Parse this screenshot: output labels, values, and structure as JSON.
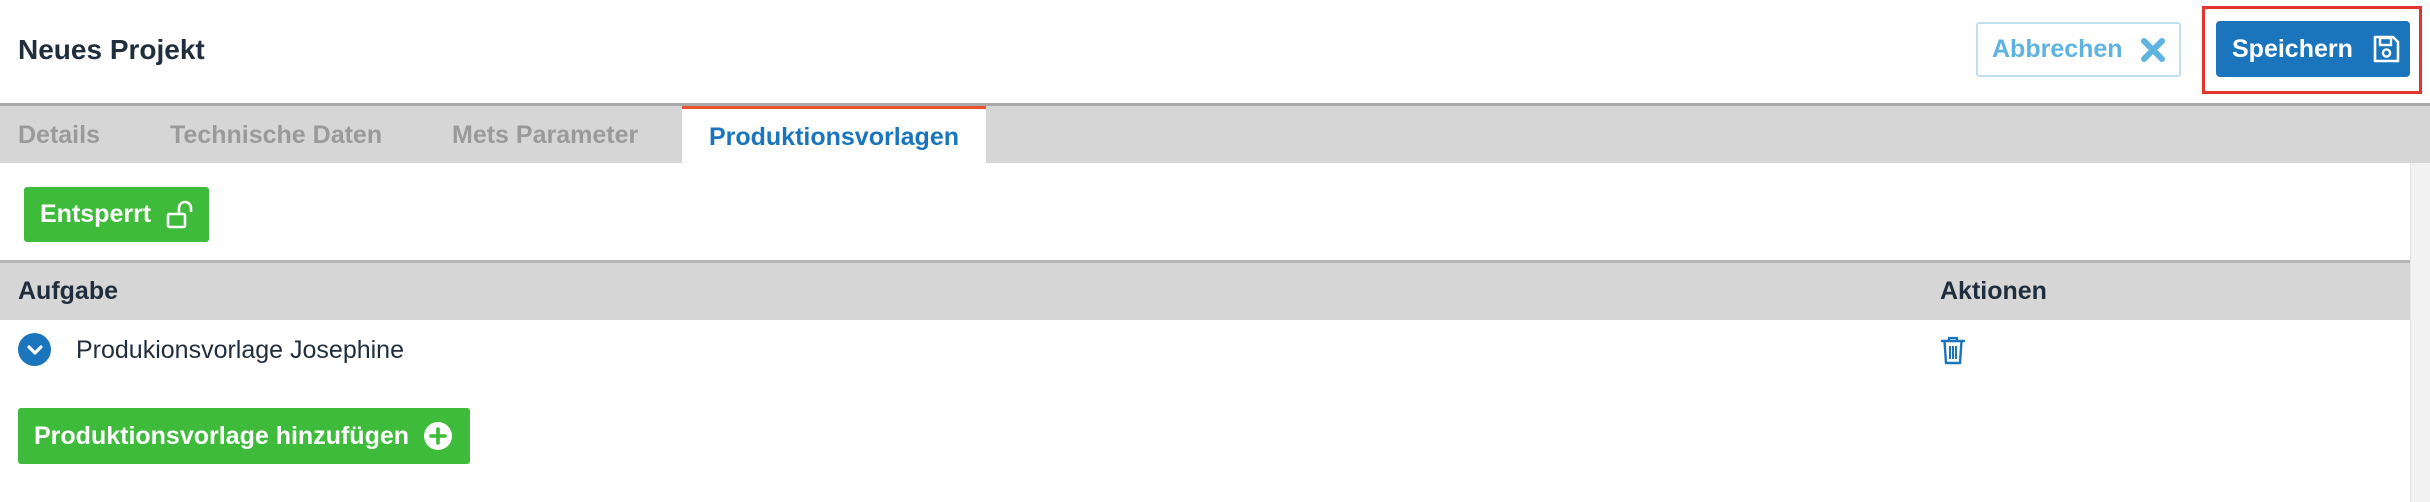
{
  "header": {
    "title": "Neues Projekt",
    "cancel_label": "Abbrechen",
    "cancel_icon": "close-icon",
    "save_label": "Speichern",
    "save_icon": "floppy-disk-icon"
  },
  "tabs": [
    {
      "label": "Details",
      "active": false
    },
    {
      "label": "Technische Daten",
      "active": false
    },
    {
      "label": "Mets Parameter",
      "active": false
    },
    {
      "label": "Produktionsvorlagen",
      "active": true
    }
  ],
  "toolbar": {
    "lock_label": "Entsperrt",
    "lock_icon": "unlocked-padlock-icon"
  },
  "table": {
    "columns": [
      "Aufgabe",
      "Aktionen"
    ],
    "rows": [
      {
        "aufgabe": "Produkionsvorlage Josephine",
        "expand_icon": "chevron-down-circle-icon",
        "action_icon": "trash-icon"
      }
    ]
  },
  "add_button": {
    "label": "Produktionsvorlage hinzufügen",
    "icon": "plus-circle-icon"
  },
  "colors": {
    "primary": "#1b75bc",
    "green": "#3ebb3a",
    "active_tab_accent": "#e9502b",
    "highlight": "#e3342f"
  }
}
